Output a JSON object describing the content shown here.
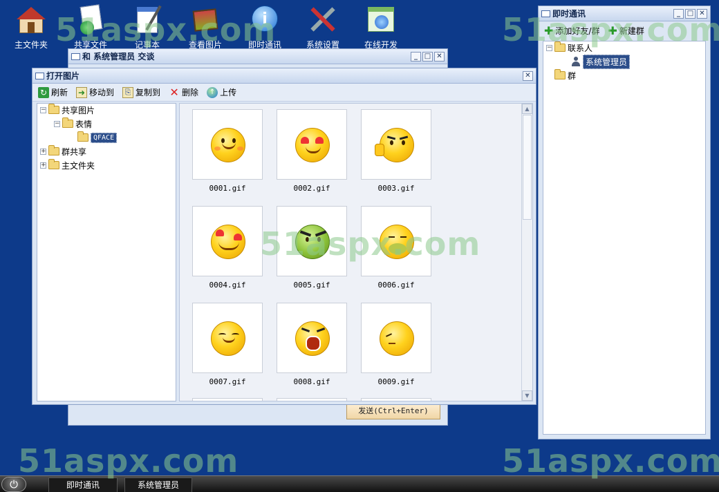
{
  "desktop": {
    "icons": [
      {
        "label": "主文件夹",
        "icon": "home-icon"
      },
      {
        "label": "共享文件",
        "icon": "shared-files-icon"
      },
      {
        "label": "记事本",
        "icon": "notepad-icon"
      },
      {
        "label": "查看图片",
        "icon": "pictures-icon"
      },
      {
        "label": "即时通讯",
        "icon": "chat-info-icon"
      },
      {
        "label": "系统设置",
        "icon": "settings-tools-icon"
      },
      {
        "label": "在线开发",
        "icon": "online-dev-icon"
      }
    ],
    "watermark": "51aspx.com"
  },
  "chat_window": {
    "title": "和 系统管理员 交谈",
    "send_button": "发送(Ctrl+Enter)"
  },
  "open_picture": {
    "title": "打开图片",
    "toolbar": {
      "refresh": "刷新",
      "move_to": "移动到",
      "copy_to": "复制到",
      "delete": "删除",
      "upload": "上传"
    },
    "tree": {
      "shared_pictures": "共享图片",
      "emoticons": "表情",
      "qface": "QFACE",
      "group_share": "群共享",
      "home_folder": "主文件夹"
    },
    "files": [
      "0001.gif",
      "0002.gif",
      "0003.gif",
      "0004.gif",
      "0005.gif",
      "0006.gif",
      "0007.gif",
      "0008.gif",
      "0009.gif"
    ]
  },
  "im_panel": {
    "title": "即时通讯",
    "add_friend": "添加好友/群",
    "new_group": "新建群",
    "contacts": "联系人",
    "admin": "系统管理员",
    "groups": "群"
  },
  "taskbar": {
    "items": [
      "即时通讯",
      "系统管理员"
    ]
  }
}
